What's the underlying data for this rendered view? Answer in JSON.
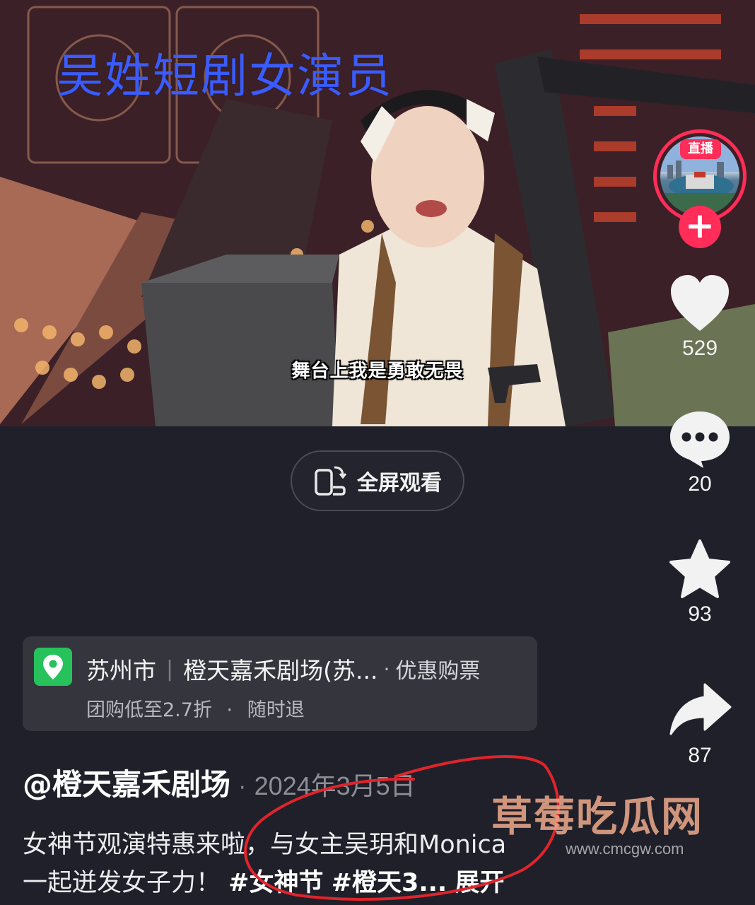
{
  "video": {
    "overlay_title": "吴姓短剧女演员",
    "subtitle": "舞台上我是勇敢无畏"
  },
  "fullscreen": {
    "label": "全屏观看"
  },
  "sidebar": {
    "live_badge": "直播",
    "follow": "+",
    "likes": "529",
    "comments": "20",
    "favorites": "93",
    "shares": "87"
  },
  "poi": {
    "city": "苏州市",
    "venue": "橙天嘉禾剧场(苏...",
    "action": "优惠购票",
    "deal": "团购低至2.7折",
    "refund": "随时退",
    "dot": "·"
  },
  "post": {
    "author": "@橙天嘉禾剧场",
    "date": "2024年3月5日",
    "desc_line1": "女神节观演特惠来啦，与女主吴玥和Monica",
    "desc_line2_text": "一起迸发女子力！",
    "tag1": "#女神节",
    "tag2": "#橙天3",
    "ellipsis": "...",
    "expand": "展开"
  },
  "watermark": {
    "brand": "草莓吃瓜网",
    "url": "www.cmcgw.com"
  },
  "colors": {
    "background": "#1f2029",
    "accent_red": "#ff2d58",
    "poi_green": "#28c25c",
    "overlay_blue": "#3a5cff"
  }
}
